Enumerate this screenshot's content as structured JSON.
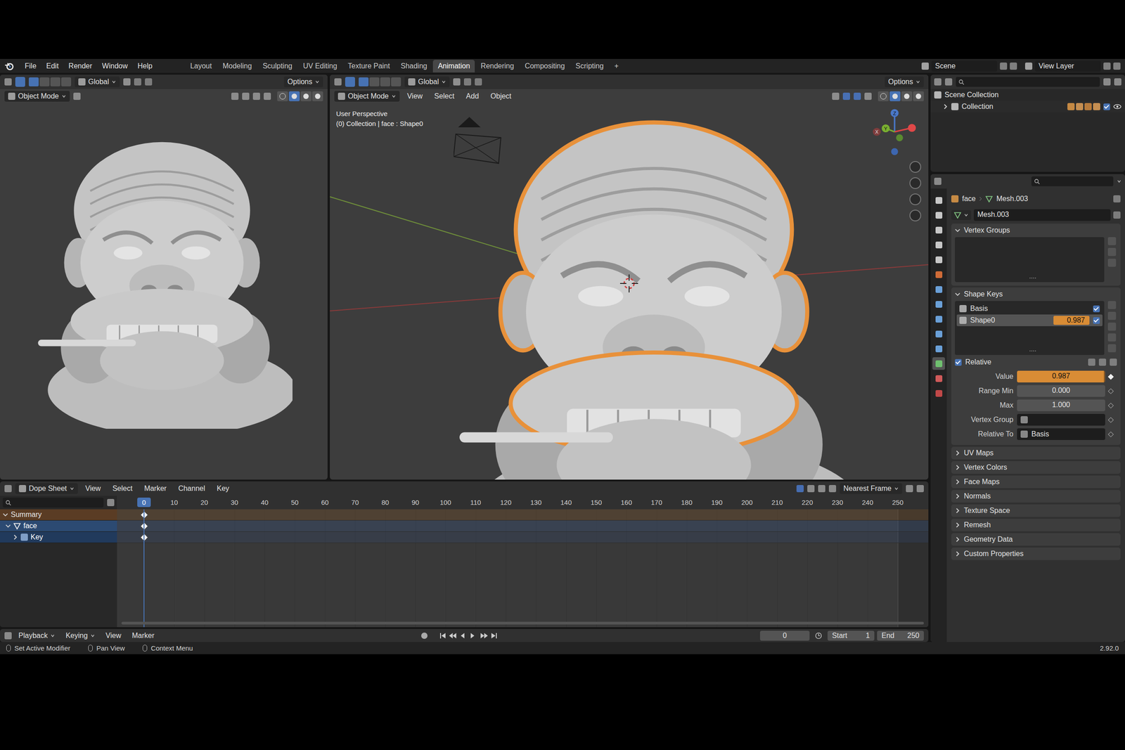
{
  "window": {
    "app": "Blender",
    "version": "2.92.0"
  },
  "menu": [
    "File",
    "Edit",
    "Render",
    "Window",
    "Help"
  ],
  "workspaces": [
    {
      "label": "Layout",
      "selected": false
    },
    {
      "label": "Modeling",
      "selected": false
    },
    {
      "label": "Sculpting",
      "selected": false
    },
    {
      "label": "UV Editing",
      "selected": false
    },
    {
      "label": "Texture Paint",
      "selected": false
    },
    {
      "label": "Shading",
      "selected": false
    },
    {
      "label": "Animation",
      "selected": true
    },
    {
      "label": "Rendering",
      "selected": false
    },
    {
      "label": "Compositing",
      "selected": false
    },
    {
      "label": "Scripting",
      "selected": false
    }
  ],
  "add_workspace": "+",
  "scene": "Scene",
  "view_layer": "View Layer",
  "left_viewport": {
    "orientation": "Global",
    "options": "Options",
    "mode": "Object Mode",
    "shading": [
      {
        "selected": false
      },
      {
        "selected": true
      },
      {
        "selected": false
      },
      {
        "selected": false
      }
    ]
  },
  "right_viewport": {
    "orientation": "Global",
    "options": "Options",
    "mode": "Object Mode",
    "menus": [
      "View",
      "Select",
      "Add",
      "Object"
    ],
    "overlay": [
      "User Perspective",
      "(0) Collection | face : Shape0"
    ],
    "gizmo_axes": [
      "X",
      "Y",
      "Z"
    ],
    "shading": [
      {
        "selected": false
      },
      {
        "selected": true
      },
      {
        "selected": false
      },
      {
        "selected": false
      }
    ]
  },
  "outliner": {
    "root": "Scene Collection",
    "children": [
      {
        "label": "Collection",
        "expanded": false,
        "checked": true,
        "visible": true
      }
    ]
  },
  "properties": {
    "breadcrumb": [
      "face",
      "Mesh.003"
    ],
    "mesh_name": "Mesh.003",
    "tabs": [
      {
        "selected": false
      },
      {
        "selected": false
      },
      {
        "selected": false
      },
      {
        "selected": false
      },
      {
        "selected": false
      },
      {
        "selected": false
      },
      {
        "selected": false
      },
      {
        "selected": false
      },
      {
        "selected": false
      },
      {
        "selected": false
      },
      {
        "selected": false
      },
      {
        "selected": true
      },
      {
        "selected": false
      },
      {
        "selected": false
      }
    ],
    "vertex_groups": {
      "title": "Vertex Groups",
      "expanded": true
    },
    "shape_keys": {
      "title": "Shape Keys",
      "expanded": true,
      "keys": [
        {
          "name": "Basis",
          "value": "",
          "selected": false,
          "enabled": true
        },
        {
          "name": "Shape0",
          "value": "0.987",
          "selected": true,
          "enabled": true
        }
      ],
      "relative": {
        "label": "Relative",
        "checked": true
      },
      "fields": [
        {
          "label": "Value",
          "value": "0.987",
          "kind": "slider",
          "level": 0.987,
          "keyframed": true
        },
        {
          "label": "Range Min",
          "value": "0.000",
          "kind": "number",
          "keyframed": false
        },
        {
          "label": "Max",
          "value": "1.000",
          "kind": "number",
          "keyframed": false
        },
        {
          "label": "Vertex Group",
          "value": "",
          "kind": "search",
          "keyframed": false
        },
        {
          "label": "Relative To",
          "value": "Basis",
          "kind": "search",
          "keyframed": false
        }
      ]
    },
    "collapsed_sections": [
      "UV Maps",
      "Vertex Colors",
      "Face Maps",
      "Normals",
      "Texture Space",
      "Remesh",
      "Geometry Data",
      "Custom Properties"
    ]
  },
  "dope_sheet": {
    "editor": "Dope Sheet",
    "menus": [
      "View",
      "Select",
      "Marker",
      "Channel",
      "Key"
    ],
    "snap": "Nearest Frame",
    "current_frame": "0",
    "ruler": [
      "10",
      "20",
      "30",
      "40",
      "50",
      "60",
      "70",
      "80",
      "90",
      "100",
      "110",
      "120",
      "130",
      "140",
      "150",
      "160",
      "170",
      "180",
      "190",
      "200",
      "210",
      "220",
      "230",
      "240",
      "250"
    ],
    "channels": [
      {
        "name": "Summary",
        "kind": "summary",
        "expanded": true,
        "selected": false
      },
      {
        "name": "face",
        "kind": "object",
        "expanded": true,
        "selected": true
      },
      {
        "name": "Key",
        "kind": "shapekey",
        "expanded": false,
        "selected": true
      }
    ],
    "keyframes": [
      0
    ]
  },
  "timeline": {
    "menus": [
      "Playback",
      "Keying",
      "View",
      "Marker"
    ],
    "frame": "0",
    "start": {
      "label": "Start",
      "value": "1"
    },
    "end": {
      "label": "End",
      "value": "250"
    }
  },
  "status": {
    "hints": [
      "Set Active Modifier",
      "Pan View",
      "Context Menu"
    ],
    "version": "2.92.0"
  }
}
